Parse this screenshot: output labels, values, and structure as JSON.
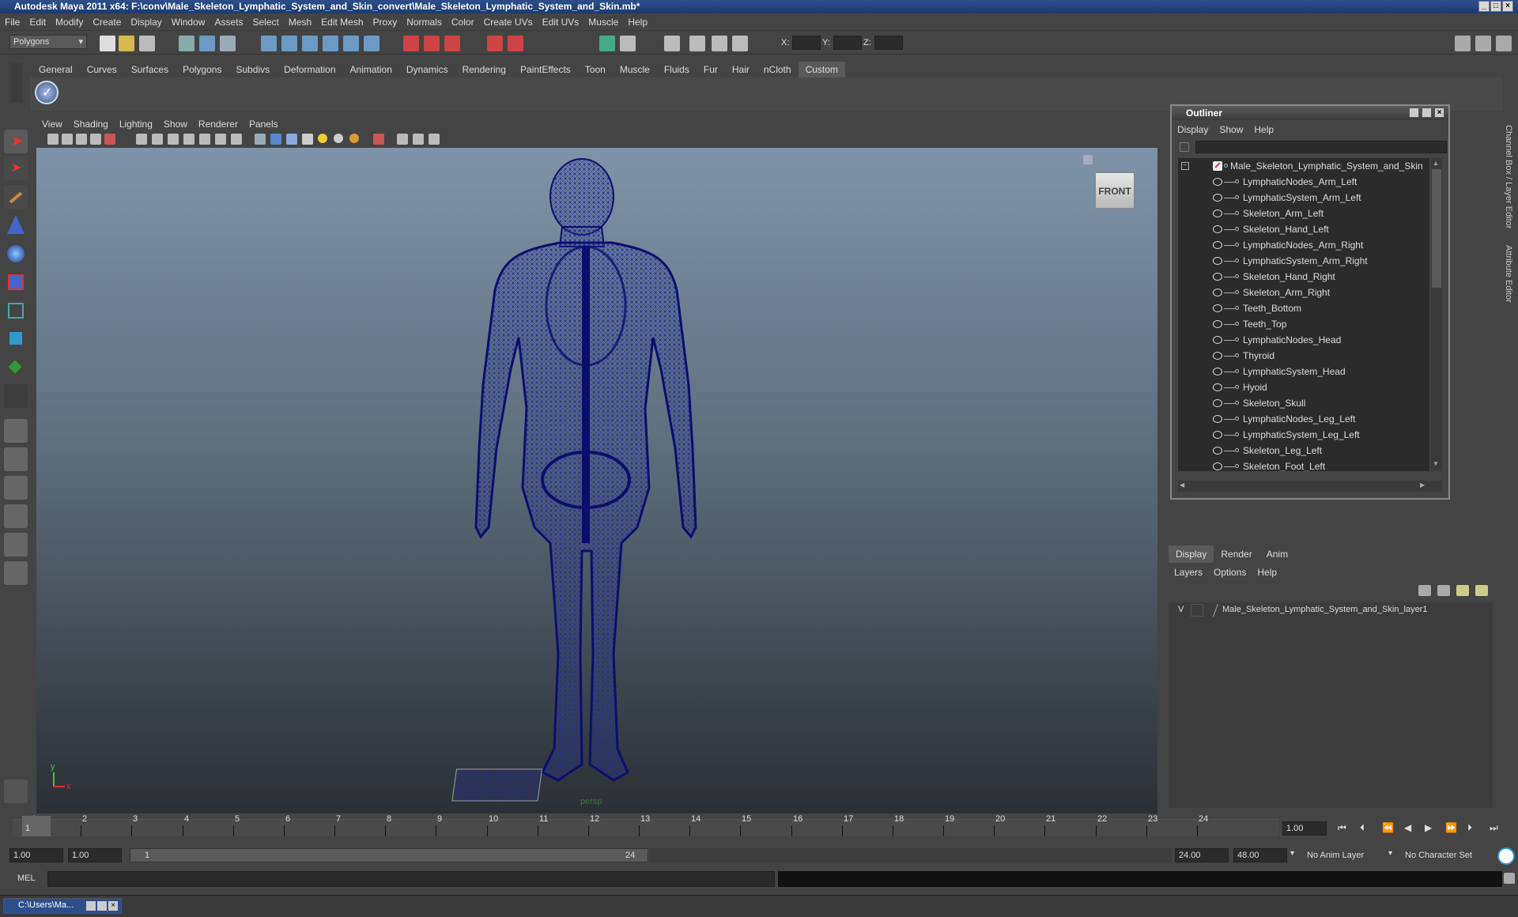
{
  "window": {
    "title": "Autodesk Maya 2011 x64: F:\\conv\\Male_Skeleton_Lymphatic_System_and_Skin_convert\\Male_Skeleton_Lymphatic_System_and_Skin.mb*"
  },
  "menu": [
    "File",
    "Edit",
    "Modify",
    "Create",
    "Display",
    "Window",
    "Assets",
    "Select",
    "Mesh",
    "Edit Mesh",
    "Proxy",
    "Normals",
    "Color",
    "Create UVs",
    "Edit UVs",
    "Muscle",
    "Help"
  ],
  "statusline": {
    "mode": "Polygons",
    "x_label": "X:",
    "y_label": "Y:",
    "z_label": "Z:"
  },
  "shelf_tabs": [
    "General",
    "Curves",
    "Surfaces",
    "Polygons",
    "Subdivs",
    "Deformation",
    "Animation",
    "Dynamics",
    "Rendering",
    "PaintEffects",
    "Toon",
    "Muscle",
    "Fluids",
    "Fur",
    "Hair",
    "nCloth",
    "Custom"
  ],
  "shelf_active": "Custom",
  "viewport": {
    "menu": [
      "View",
      "Shading",
      "Lighting",
      "Show",
      "Renderer",
      "Panels"
    ],
    "camera_label": "persp",
    "viewcube_label": "FRONT",
    "axis_y": "y",
    "axis_x": "x",
    "model_color": "#0a0f6e"
  },
  "outliner": {
    "title": "Outliner",
    "menu": [
      "Display",
      "Show",
      "Help"
    ],
    "root": "Male_Skeleton_Lymphatic_System_and_Skin",
    "items": [
      "LymphaticNodes_Arm_Left",
      "LymphaticSystem_Arm_Left",
      "Skeleton_Arm_Left",
      "Skeleton_Hand_Left",
      "LymphaticNodes_Arm_Right",
      "LymphaticSystem_Arm_Right",
      "Skeleton_Hand_Right",
      "Skeleton_Arm_Right",
      "Teeth_Bottom",
      "Teeth_Top",
      "LymphaticNodes_Head",
      "Thyroid",
      "LymphaticSystem_Head",
      "Hyoid",
      "Skeleton_Skull",
      "LymphaticNodes_Leg_Left",
      "LymphaticSystem_Leg_Left",
      "Skeleton_Leg_Left",
      "Skeleton_Foot_Left"
    ]
  },
  "side_tabs": [
    "Channel Box / Layer Editor",
    "Attribute Editor"
  ],
  "layers": {
    "tabs": [
      "Display",
      "Render",
      "Anim"
    ],
    "menu": [
      "Layers",
      "Options",
      "Help"
    ],
    "layer_visible": "V",
    "layer_name": "Male_Skeleton_Lymphatic_System_and_Skin_layer1"
  },
  "timeline": {
    "ticks": [
      "1",
      "2",
      "3",
      "4",
      "5",
      "6",
      "7",
      "8",
      "9",
      "10",
      "11",
      "12",
      "13",
      "14",
      "15",
      "16",
      "17",
      "18",
      "19",
      "20",
      "21",
      "22",
      "23",
      "24"
    ],
    "current_frame": "1",
    "current_time_field": "1.00"
  },
  "range": {
    "start": "1.00",
    "anim_start": "1.00",
    "range_start": "1",
    "range_end": "24",
    "anim_end": "24.00",
    "end": "48.00",
    "anim_layer": "No Anim Layer",
    "character_set": "No Character Set"
  },
  "cmdline": {
    "label": "MEL"
  },
  "taskbar": {
    "item": "C:\\Users\\Ma..."
  }
}
